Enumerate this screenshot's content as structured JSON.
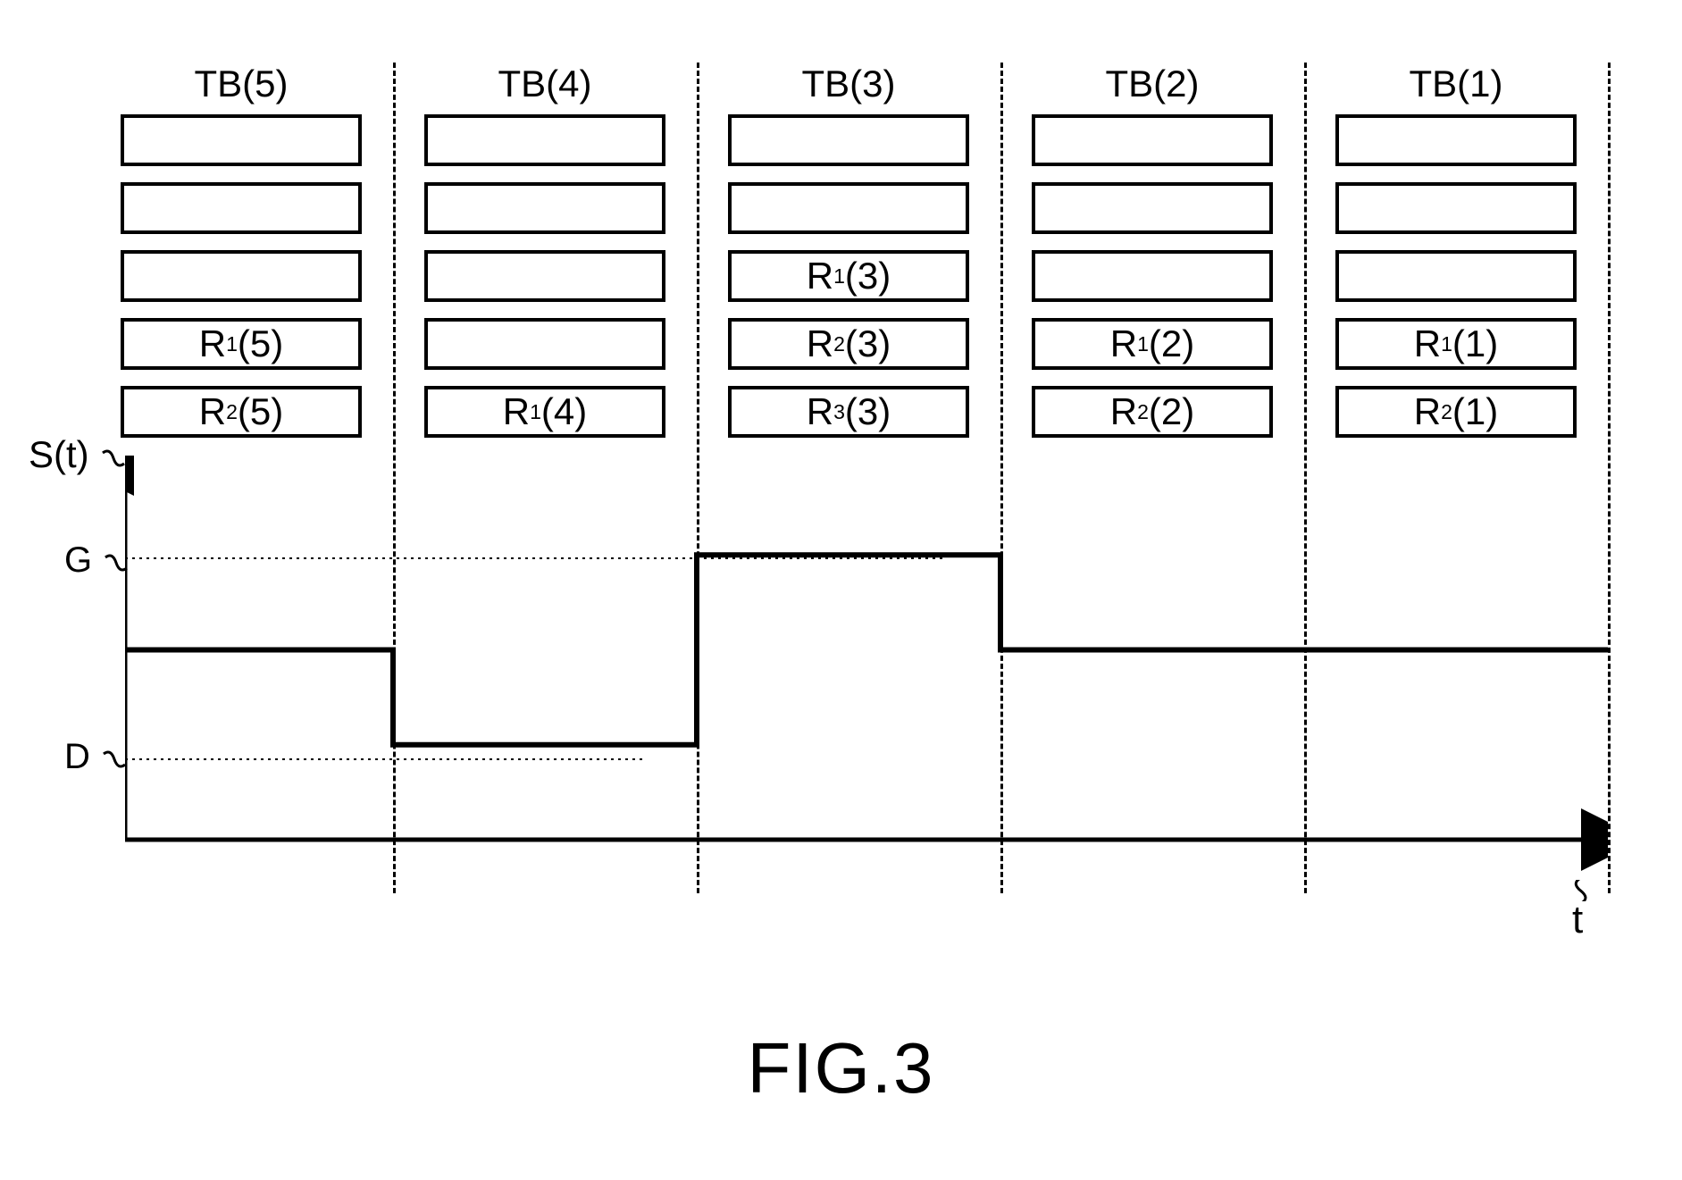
{
  "figure_caption": "FIG.3",
  "yaxis": {
    "label": "S(t)",
    "ticks": [
      "G",
      "D"
    ]
  },
  "xaxis": {
    "label": "t"
  },
  "columns": [
    {
      "header": "TB(5)",
      "rows": [
        "",
        "",
        "",
        "R1(5)",
        "R2(5)"
      ]
    },
    {
      "header": "TB(4)",
      "rows": [
        "",
        "",
        "",
        "",
        "R1(4)"
      ]
    },
    {
      "header": "TB(3)",
      "rows": [
        "",
        "",
        "R1(3)",
        "R2(3)",
        "R3(3)"
      ]
    },
    {
      "header": "TB(2)",
      "rows": [
        "",
        "",
        "",
        "R1(2)",
        "R2(2)"
      ]
    },
    {
      "header": "TB(1)",
      "rows": [
        "",
        "",
        "",
        "R1(1)",
        "R2(1)"
      ]
    }
  ],
  "chart_data": {
    "type": "line",
    "title": "",
    "xlabel": "t",
    "ylabel": "S(t)",
    "y_reference_levels": {
      "G": 3,
      "D": 1
    },
    "categories": [
      "TB(5)",
      "TB(4)",
      "TB(3)",
      "TB(2)",
      "TB(1)"
    ],
    "values": [
      2,
      1,
      3,
      2,
      2
    ],
    "ylim": [
      0,
      3.2
    ]
  }
}
